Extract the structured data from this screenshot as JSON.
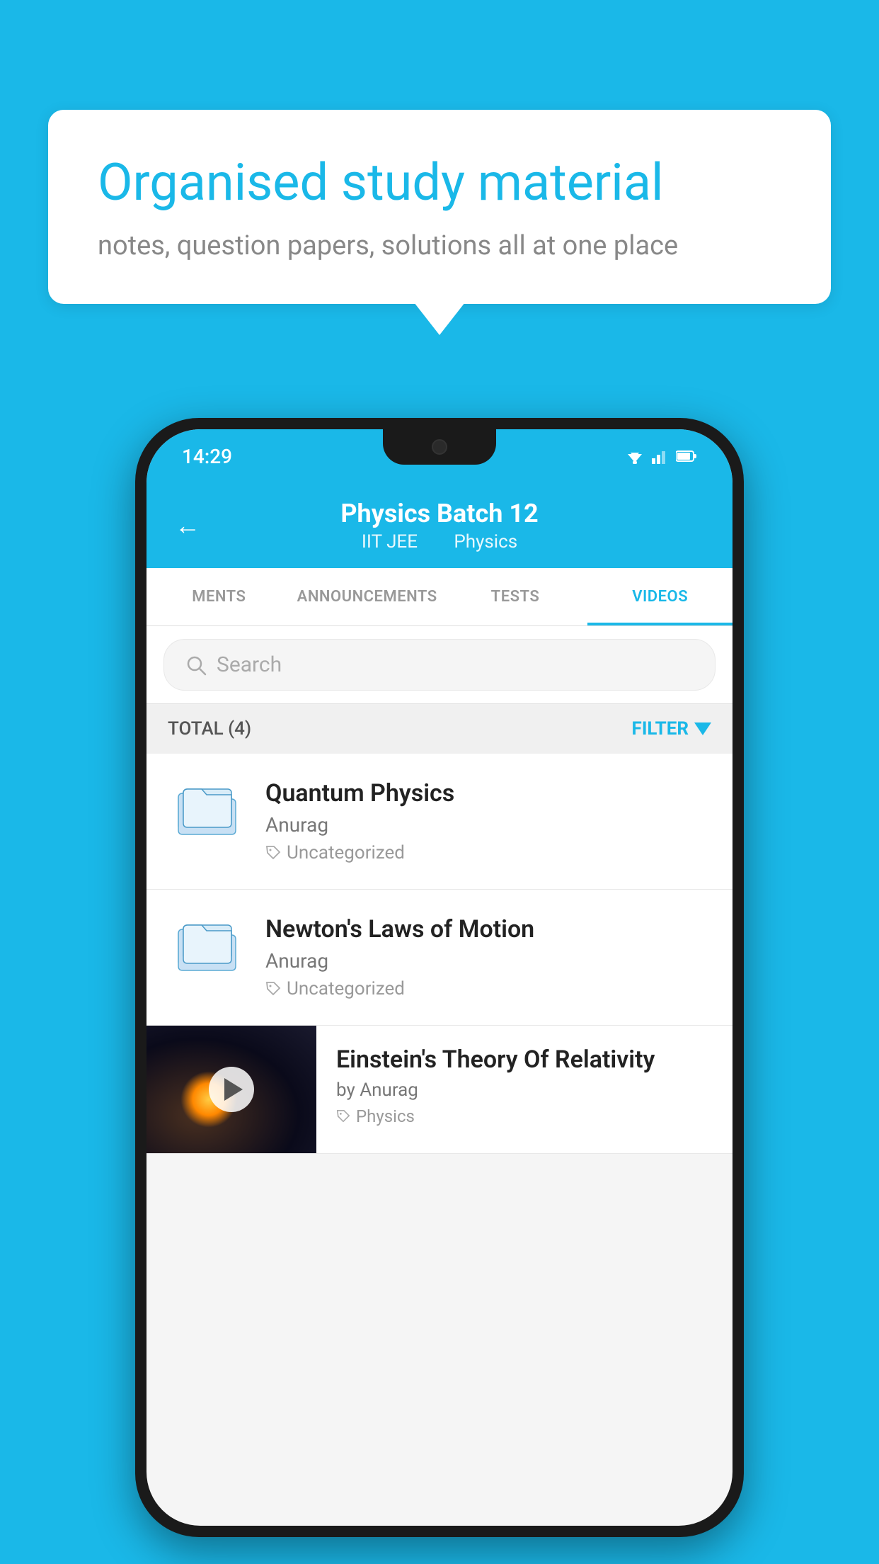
{
  "background": {
    "color": "#1ab8e8"
  },
  "hero": {
    "title": "Organised study material",
    "subtitle": "notes, question papers, solutions all at one place"
  },
  "phone": {
    "status_bar": {
      "time": "14:29",
      "icons": [
        "wifi",
        "signal",
        "battery"
      ]
    },
    "header": {
      "back_label": "←",
      "title": "Physics Batch 12",
      "subtitle_part1": "IIT JEE",
      "subtitle_part2": "Physics"
    },
    "tabs": [
      {
        "label": "MENTS",
        "active": false
      },
      {
        "label": "ANNOUNCEMENTS",
        "active": false
      },
      {
        "label": "TESTS",
        "active": false
      },
      {
        "label": "VIDEOS",
        "active": true
      }
    ],
    "search": {
      "placeholder": "Search"
    },
    "filter": {
      "total_label": "TOTAL (4)",
      "filter_label": "FILTER"
    },
    "videos": [
      {
        "id": 1,
        "title": "Quantum Physics",
        "author": "Anurag",
        "tag": "Uncategorized",
        "has_thumbnail": false
      },
      {
        "id": 2,
        "title": "Newton's Laws of Motion",
        "author": "Anurag",
        "tag": "Uncategorized",
        "has_thumbnail": false
      },
      {
        "id": 3,
        "title": "Einstein's Theory Of Relativity",
        "author": "by Anurag",
        "tag": "Physics",
        "has_thumbnail": true
      }
    ]
  }
}
